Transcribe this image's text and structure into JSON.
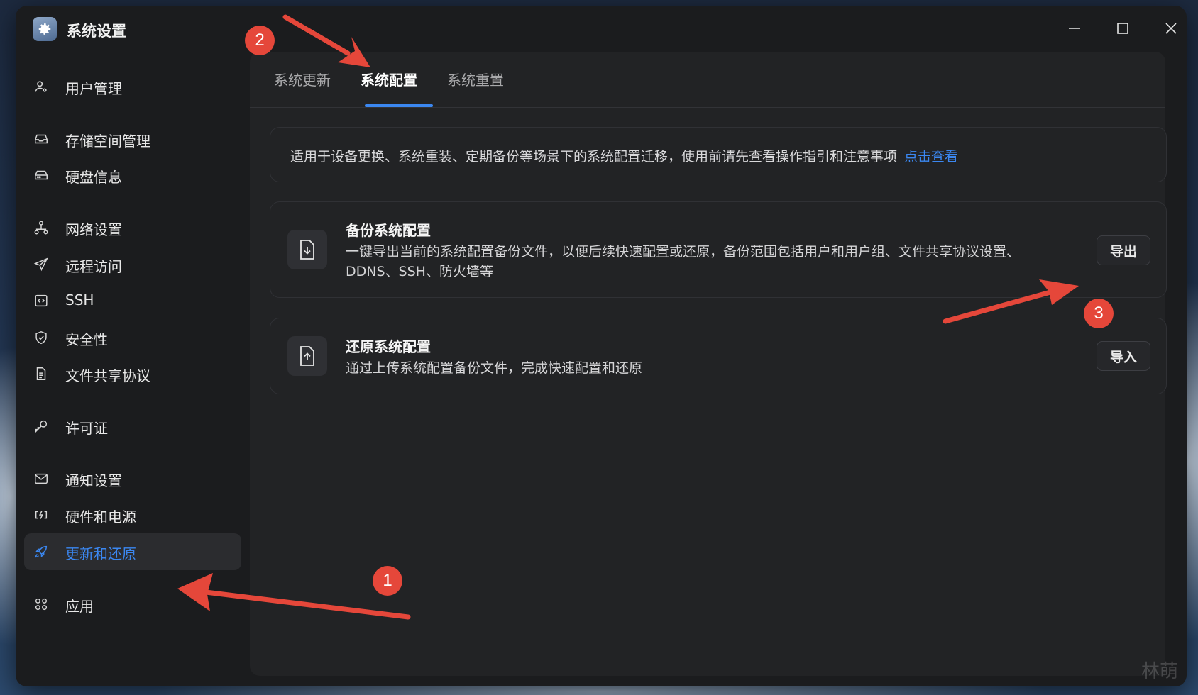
{
  "window": {
    "title": "系统设置",
    "icon": "gear-icon",
    "controls": [
      "minimize-icon",
      "maximize-icon",
      "close-icon"
    ]
  },
  "sidebar": {
    "items": [
      {
        "label": "用户管理",
        "icon": "user-icon"
      },
      {
        "label": "存储空间管理",
        "icon": "storage-icon"
      },
      {
        "label": "硬盘信息",
        "icon": "disk-icon"
      },
      {
        "label": "网络设置",
        "icon": "network-icon"
      },
      {
        "label": "远程访问",
        "icon": "send-icon"
      },
      {
        "label": "SSH",
        "icon": "terminal-icon"
      },
      {
        "label": "安全性",
        "icon": "shield-icon"
      },
      {
        "label": "文件共享协议",
        "icon": "document-icon"
      },
      {
        "label": "许可证",
        "icon": "key-icon"
      },
      {
        "label": "通知设置",
        "icon": "mail-icon"
      },
      {
        "label": "硬件和电源",
        "icon": "power-icon"
      },
      {
        "label": "更新和还原",
        "icon": "rocket-icon",
        "active": true
      },
      {
        "label": "应用",
        "icon": "apps-icon"
      }
    ]
  },
  "tabs": [
    {
      "label": "系统更新"
    },
    {
      "label": "系统配置",
      "active": true
    },
    {
      "label": "系统重置"
    }
  ],
  "info": {
    "text": "适用于设备更换、系统重装、定期备份等场景下的系统配置迁移，使用前请先查看操作指引和注意事项",
    "link": "点击查看"
  },
  "backup": {
    "title": "备份系统配置",
    "description": "一键导出当前的系统配置备份文件，以便后续快速配置或还原，备份范围包括用户和用户组、文件共享协议设置、DDNS、SSH、防火墙等",
    "button": "导出",
    "icon": "file-download-icon"
  },
  "restore": {
    "title": "还原系统配置",
    "description": "通过上传系统配置备份文件，完成快速配置和还原",
    "button": "导入",
    "icon": "file-upload-icon"
  },
  "annotations": {
    "badges": [
      "1",
      "2",
      "3"
    ],
    "color": "#e5473a"
  },
  "colors": {
    "accent": "#3b87f0",
    "window_bg": "#1b1c1e",
    "panel_bg": "#222325"
  },
  "watermark": "林萌"
}
